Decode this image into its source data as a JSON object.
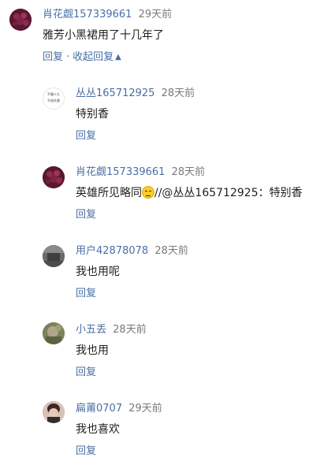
{
  "comments": [
    {
      "user": "肖花觑157339661",
      "time": "29天前",
      "text": "雅芳小黑裙用了十几年了",
      "reply_label": "回复",
      "collapse_label": "收起回复",
      "avatar_color": "#6b1f3a"
    },
    {
      "user": "丛丛165712925",
      "time": "28天前",
      "text": "特别香",
      "reply_label": "回复",
      "avatar_text_1": "不服十九",
      "avatar_text_2": "不战头香"
    },
    {
      "user": "肖花觑157339661",
      "time": "28天前",
      "text_before": "英雄所见略同",
      "text_after": "//@丛丛165712925：特别香",
      "reply_label": "回复",
      "avatar_color": "#6b1f3a"
    },
    {
      "user": "用户42878078",
      "time": "28天前",
      "text": "我也用呢",
      "reply_label": "回复",
      "avatar_color": "#5a5a5a"
    },
    {
      "user": "小五丢",
      "time": "28天前",
      "text": "我也用",
      "reply_label": "回复",
      "avatar_color": "#8a8a5a"
    },
    {
      "user": "扁莆0707",
      "time": "29天前",
      "text": "我也喜欢",
      "reply_label": "回复",
      "avatar_color": "#caa79a"
    }
  ]
}
